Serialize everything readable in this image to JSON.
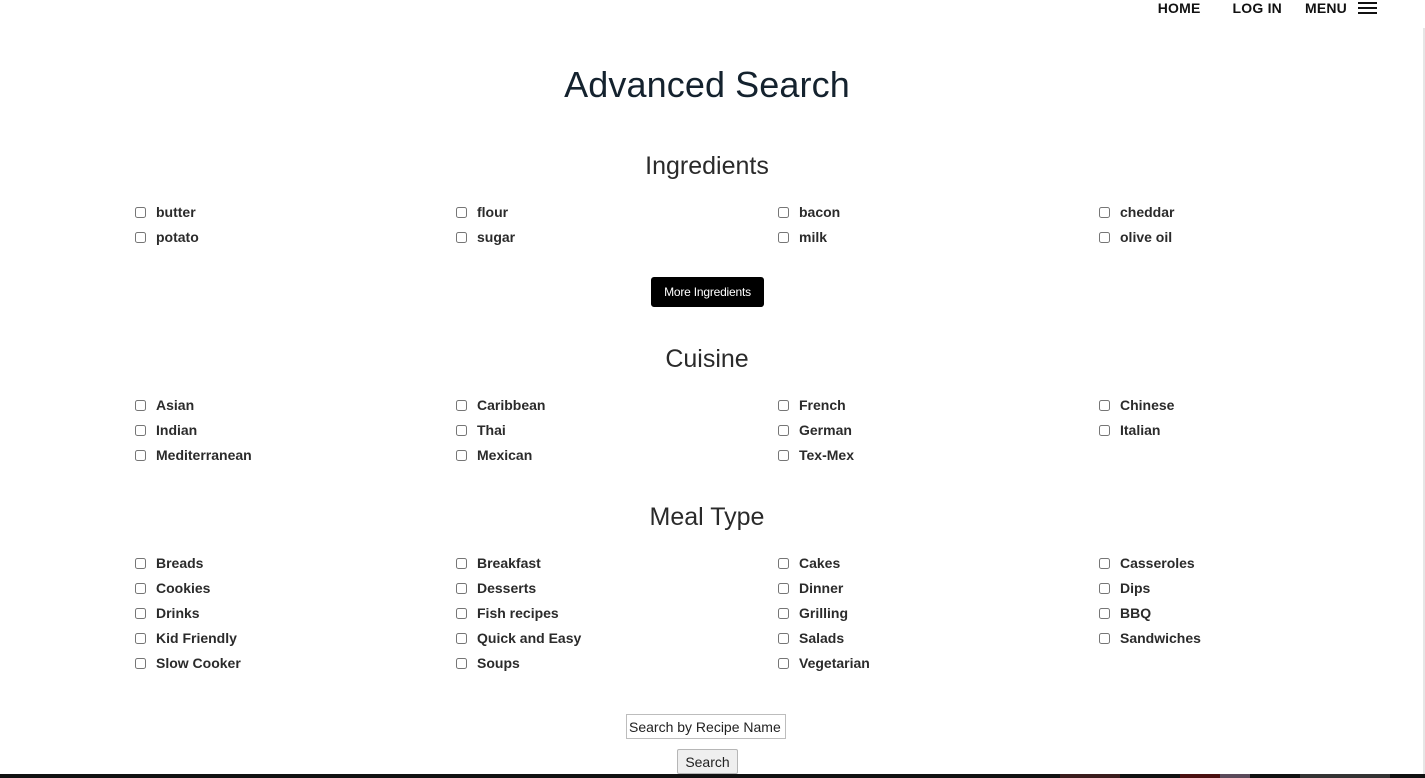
{
  "nav": {
    "home": "HOME",
    "login": "LOG IN",
    "menu": "MENU",
    "menu_icon": "hamburger-icon"
  },
  "page_title": "Advanced Search",
  "sections": [
    {
      "title": "Ingredients",
      "items": [
        "butter",
        "flour",
        "bacon",
        "cheddar",
        "potato",
        "sugar",
        "milk",
        "olive oil"
      ]
    },
    {
      "title": "Cuisine",
      "items": [
        "Asian",
        "Caribbean",
        "French",
        "Chinese",
        "Indian",
        "Thai",
        "German",
        "Italian",
        "Mediterranean",
        "Mexican",
        "Tex-Mex"
      ]
    },
    {
      "title": "Meal Type",
      "items": [
        "Breads",
        "Breakfast",
        "Cakes",
        "Casseroles",
        "Cookies",
        "Desserts",
        "Dinner",
        "Dips",
        "Drinks",
        "Fish recipes",
        "Grilling",
        "BBQ",
        "Kid Friendly",
        "Quick and Easy",
        "Salads",
        "Sandwiches",
        "Slow Cooker",
        "Soups",
        "Vegetarian"
      ]
    }
  ],
  "more_ingredients_label": "More Ingredients",
  "search": {
    "placeholder": "Search by Recipe Name",
    "button_label": "Search"
  },
  "colors": {
    "title": "#14222e",
    "button_dark": "#000000",
    "button_light": "#efefef"
  }
}
